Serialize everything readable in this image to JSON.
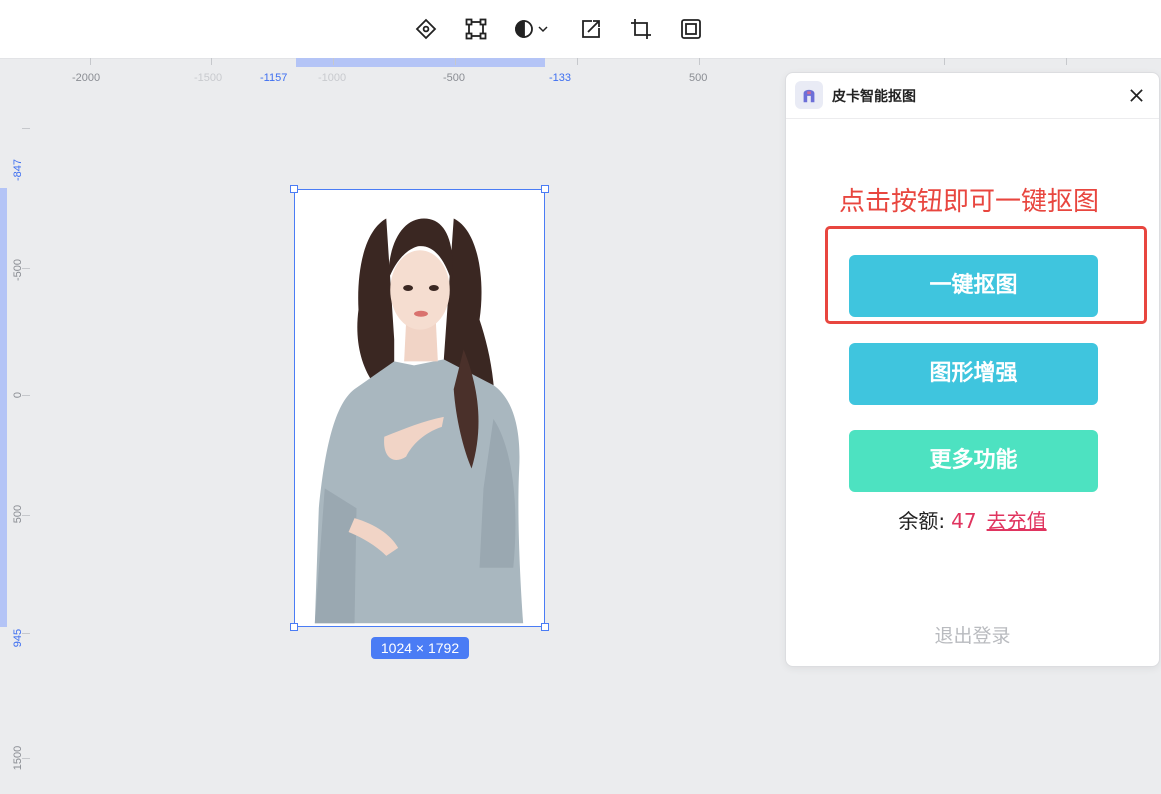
{
  "toolbar": {
    "tools": [
      {
        "name": "pen-tool-icon"
      },
      {
        "name": "transform-tool-icon"
      },
      {
        "name": "contrast-tool-icon"
      },
      {
        "name": "resize-tool-icon"
      },
      {
        "name": "crop-tool-icon"
      },
      {
        "name": "frame-tool-icon"
      }
    ]
  },
  "ruler": {
    "top": {
      "n2000": "-2000",
      "n1500": "-1500",
      "sel_start": "-1157",
      "n1000": "-1000",
      "n500": "-500",
      "sel_end": "-133",
      "p500": "500"
    },
    "left": {
      "sel_start": "-847",
      "n500": "-500",
      "zero": "0",
      "p500": "500",
      "sel_end": "945",
      "p1500": "1500"
    }
  },
  "canvas": {
    "size_badge": "1024 × 1792"
  },
  "panel": {
    "title": "皮卡智能抠图",
    "hint": "点击按钮即可一键抠图",
    "buttons": {
      "cutout": "一键抠图",
      "enhance": "图形增强",
      "more": "更多功能"
    },
    "balance_label": "余额:",
    "balance_value": "47",
    "recharge": "去充值",
    "logout": "退出登录"
  },
  "colors": {
    "accent": "#4a7cf5",
    "button_blue": "#3fc5de",
    "button_teal": "#4de2c1",
    "hint_red": "#e8463f",
    "balance_pink": "#e0345f"
  }
}
